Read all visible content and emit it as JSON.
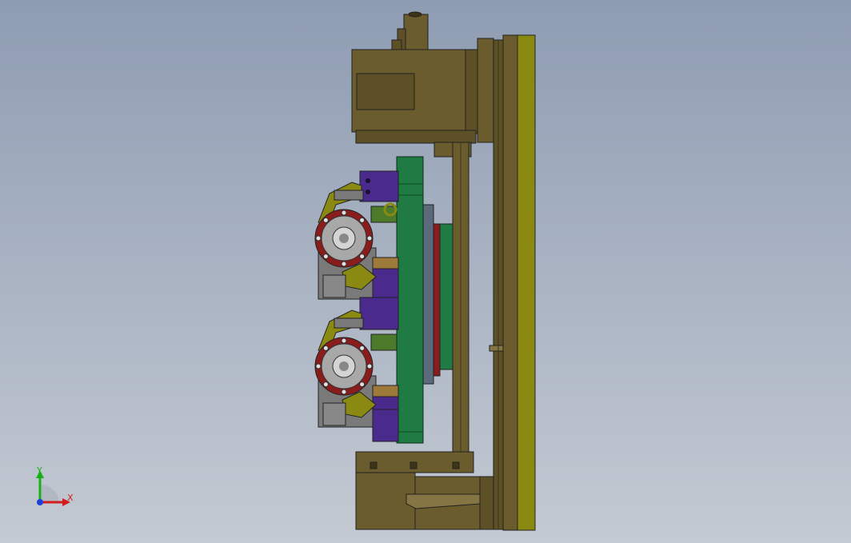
{
  "viewport": {
    "background_top": "#8e9cb2",
    "background_bottom": "#c4cad3"
  },
  "colors": {
    "bronze": "#6b5c2e",
    "bronze_dark": "#3d3416",
    "bronze_light": "#857444",
    "olive_plate": "#8a8a12",
    "green_plate": "#1f7a43",
    "green_dark": "#0e4a24",
    "purple_cylinder": "#4a2a8c",
    "red_flange": "#8a1c1c",
    "gray_part": "#7a7a7a",
    "steel_blue": "#5a6a7a"
  },
  "components": {
    "clamp_units": 2,
    "flange_bolts": 8
  },
  "triad": {
    "x_label": "X",
    "y_label": "Y",
    "x_color": "#d11d1d",
    "y_color": "#17b117",
    "z_color": "#1f3fd9"
  }
}
